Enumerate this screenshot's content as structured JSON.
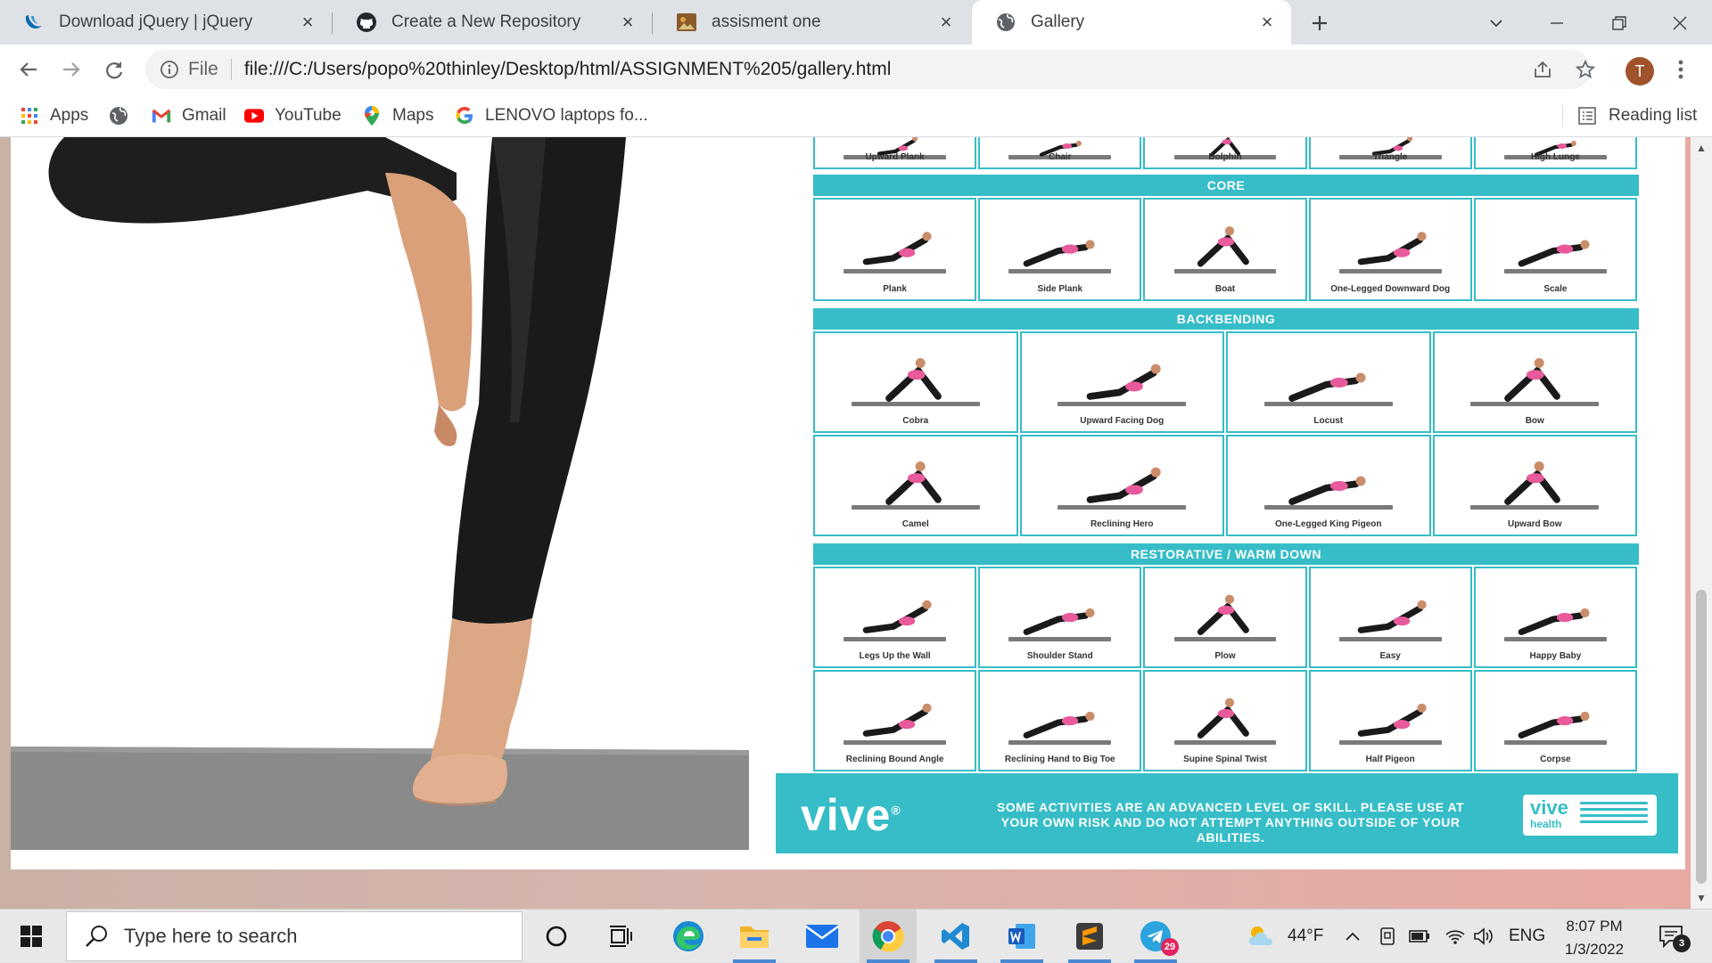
{
  "tabs": [
    {
      "title": "Download jQuery | jQuery",
      "favicon": "jquery-icon"
    },
    {
      "title": "Create a New Repository",
      "favicon": "github-icon"
    },
    {
      "title": "assisment one",
      "favicon": "image-thumb-icon"
    },
    {
      "title": "Gallery",
      "favicon": "globe-icon",
      "active": true
    }
  ],
  "toolbar": {
    "scheme_label": "File",
    "url": "file:///C:/Users/popo%20thinley/Desktop/html/ASSIGNMENT%205/gallery.html",
    "avatar_letter": "T"
  },
  "bookmarks": [
    {
      "label": "Apps",
      "icon": "apps-grid-icon"
    },
    {
      "label": "",
      "icon": "globe-icon"
    },
    {
      "label": "Gmail",
      "icon": "gmail-icon"
    },
    {
      "label": "YouTube",
      "icon": "youtube-icon"
    },
    {
      "label": "Maps",
      "icon": "maps-icon"
    },
    {
      "label": "LENOVO laptops fo...",
      "icon": "google-icon"
    }
  ],
  "reading_list": "Reading list",
  "poster": {
    "top_row": [
      "Upward Plank",
      "Chair",
      "Dolphin",
      "Triangle",
      "High Lunge"
    ],
    "sections": [
      {
        "title": "CORE",
        "rows": [
          [
            "Plank",
            "Side Plank",
            "Boat",
            "One-Legged Downward Dog",
            "Scale"
          ]
        ]
      },
      {
        "title": "BACKBENDING",
        "rows": [
          [
            "Cobra",
            "Upward Facing Dog",
            "Locust",
            "Bow"
          ],
          [
            "Camel",
            "Reclining Hero",
            "One-Legged King Pigeon",
            "Upward Bow"
          ]
        ]
      },
      {
        "title": "RESTORATIVE / WARM DOWN",
        "rows": [
          [
            "Legs Up the Wall",
            "Shoulder Stand",
            "Plow",
            "Easy",
            "Happy Baby"
          ],
          [
            "Reclining Bound Angle",
            "Reclining Hand to Big Toe",
            "Supine Spinal Twist",
            "Half Pigeon",
            "Corpse"
          ]
        ]
      }
    ],
    "brand": "vive",
    "brand_mark": "®",
    "disclaimer": "SOME ACTIVITIES ARE AN ADVANCED LEVEL OF SKILL. PLEASE USE AT YOUR OWN RISK AND DO NOT ATTEMPT ANYTHING OUTSIDE OF YOUR ABILITIES.",
    "stamp_brand": "vive",
    "stamp_sub": "health"
  },
  "taskbar": {
    "search_placeholder": "Type here to search",
    "weather": "44°F",
    "language": "ENG",
    "time": "8:07 PM",
    "date": "1/3/2022",
    "telegram_badge": "29",
    "notification_count": "3"
  },
  "colors": {
    "accent_teal": "#36bdc7",
    "chrome_bg": "#dee1e6"
  }
}
